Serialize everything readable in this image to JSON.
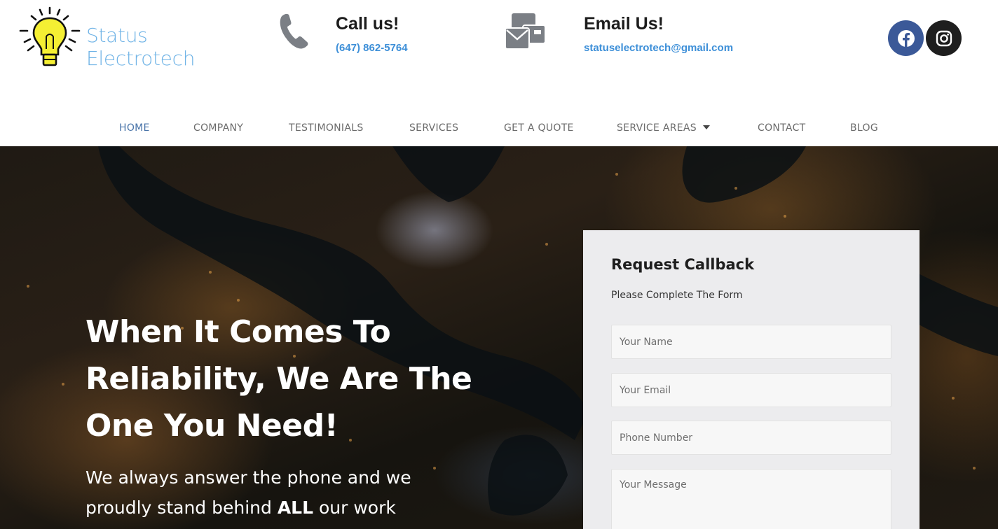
{
  "brand": {
    "name_line1": "Status",
    "name_line2": "Electrotech",
    "logo_color": "#6fb3e6",
    "bulb_color": "#f5ef33"
  },
  "contact": {
    "call_title": "Call us!",
    "call_number": "(647) 862-5764",
    "email_title": "Email Us!",
    "email_address": "statuselectrotech@gmail.com",
    "link_color": "#3d8fd8"
  },
  "social": {
    "facebook_icon": "facebook-icon",
    "instagram_icon": "instagram-icon"
  },
  "nav": {
    "items": [
      {
        "label": "HOME",
        "active": true
      },
      {
        "label": "COMPANY"
      },
      {
        "label": "TESTIMONIALS"
      },
      {
        "label": "SERVICES"
      },
      {
        "label": "GET A QUOTE"
      },
      {
        "label": "SERVICE AREAS",
        "has_dropdown": true
      },
      {
        "label": "CONTACT"
      },
      {
        "label": "BLOG"
      }
    ]
  },
  "hero": {
    "headline_line1": "When It Comes To",
    "headline_line2": "Reliability, We Are The",
    "headline_line3": "One You Need!",
    "tagline_line1": "We always answer the phone and we",
    "tagline_pre": "proudly stand behind ",
    "tagline_bold": "ALL",
    "tagline_post": " our work"
  },
  "form": {
    "title": "Request Callback",
    "subtitle": "Please Complete The Form",
    "name_placeholder": "Your Name",
    "email_placeholder": "Your Email",
    "phone_placeholder": "Phone Number",
    "message_placeholder": "Your Message"
  }
}
